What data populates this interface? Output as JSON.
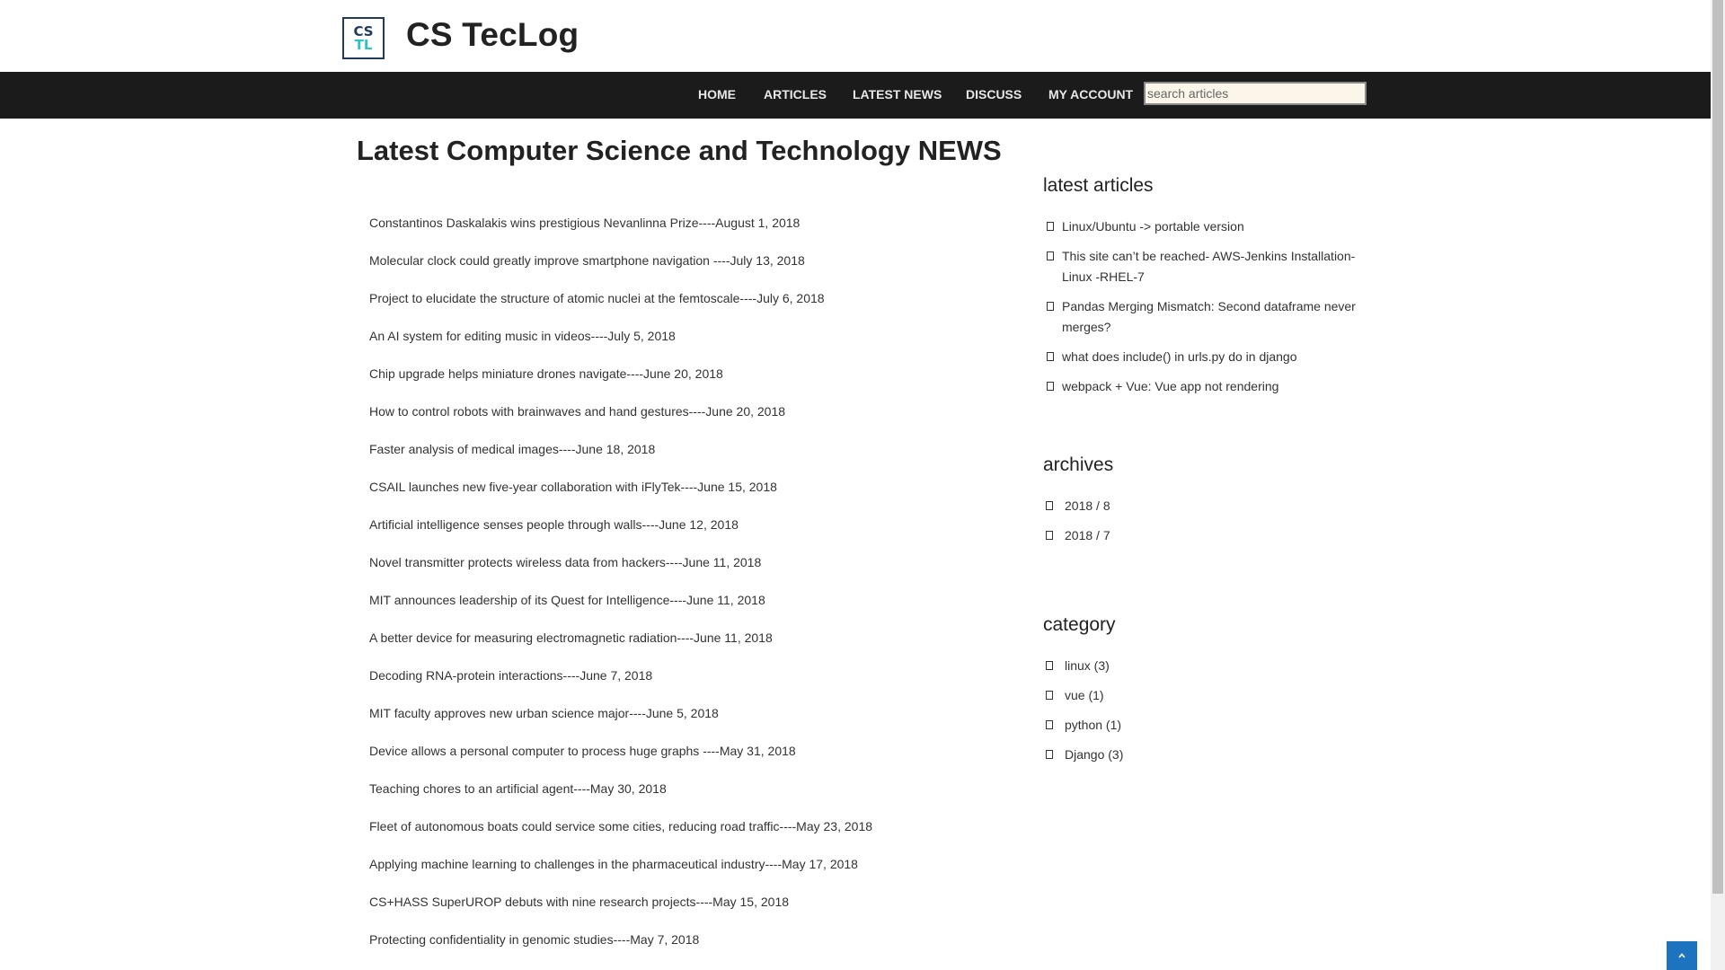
{
  "header": {
    "logo_line1": "CS",
    "logo_line2": "TL",
    "site_title": "CS TecLog"
  },
  "nav": {
    "items": [
      "HOME",
      "ARTICLES",
      "LATEST NEWS",
      "DISCUSS",
      "MY ACCOUNT"
    ],
    "search_placeholder": "search articles"
  },
  "main": {
    "title": "Latest Computer Science and Technology NEWS",
    "news": [
      "Constantinos Daskalakis wins prestigious Nevanlinna Prize----August 1, 2018",
      "Molecular clock could greatly improve smartphone navigation ----July 13, 2018",
      "Project to elucidate the structure of atomic nuclei at the femtoscale----July 6, 2018",
      "An AI system for editing music in videos----July 5, 2018",
      "Chip upgrade helps miniature drones navigate----June 20, 2018",
      "How to control robots with brainwaves and hand gestures----June 20, 2018",
      "Faster analysis of medical images----June 18, 2018",
      "CSAIL launches new five-year collaboration with iFlyTek----June 15, 2018",
      "Artificial intelligence senses people through walls----June 12, 2018",
      "Novel transmitter protects wireless data from hackers----June 11, 2018",
      "MIT announces leadership of its Quest for Intelligence----June 11, 2018",
      "A better device for measuring electromagnetic radiation----June 11, 2018",
      "Decoding RNA-protein interactions----June 7, 2018",
      "MIT faculty approves new urban science major----June 5, 2018",
      "Device allows a personal computer to process huge graphs ----May 31, 2018",
      "Teaching chores to an artificial agent----May 30, 2018",
      "Fleet of autonomous boats could service some cities, reducing road traffic----May 23, 2018",
      "Applying machine learning to challenges in the pharmaceutical industry----May 17, 2018",
      "CS+HASS SuperUROP debuts with nine research projects----May 15, 2018",
      "Protecting confidentiality in genomic studies----May 7, 2018"
    ]
  },
  "sidebar": {
    "latest_heading": "latest articles",
    "latest_articles": [
      "Linux/Ubuntu -> portable version",
      "This site can’t be reached- AWS-Jenkins Installation-Linux -RHEL-7",
      "Pandas Merging Mismatch: Second dataframe never merges?",
      "what does include() in urls.py do in django",
      "webpack + Vue: Vue app not rendering"
    ],
    "archives_heading": "archives",
    "archives": [
      "2018 / 8",
      "2018 / 7"
    ],
    "category_heading": "category",
    "categories": [
      "linux (3)",
      "vue (1)",
      "python (1)",
      "Django (3)"
    ]
  },
  "back_to_top_icon": "chevron-up-icon"
}
